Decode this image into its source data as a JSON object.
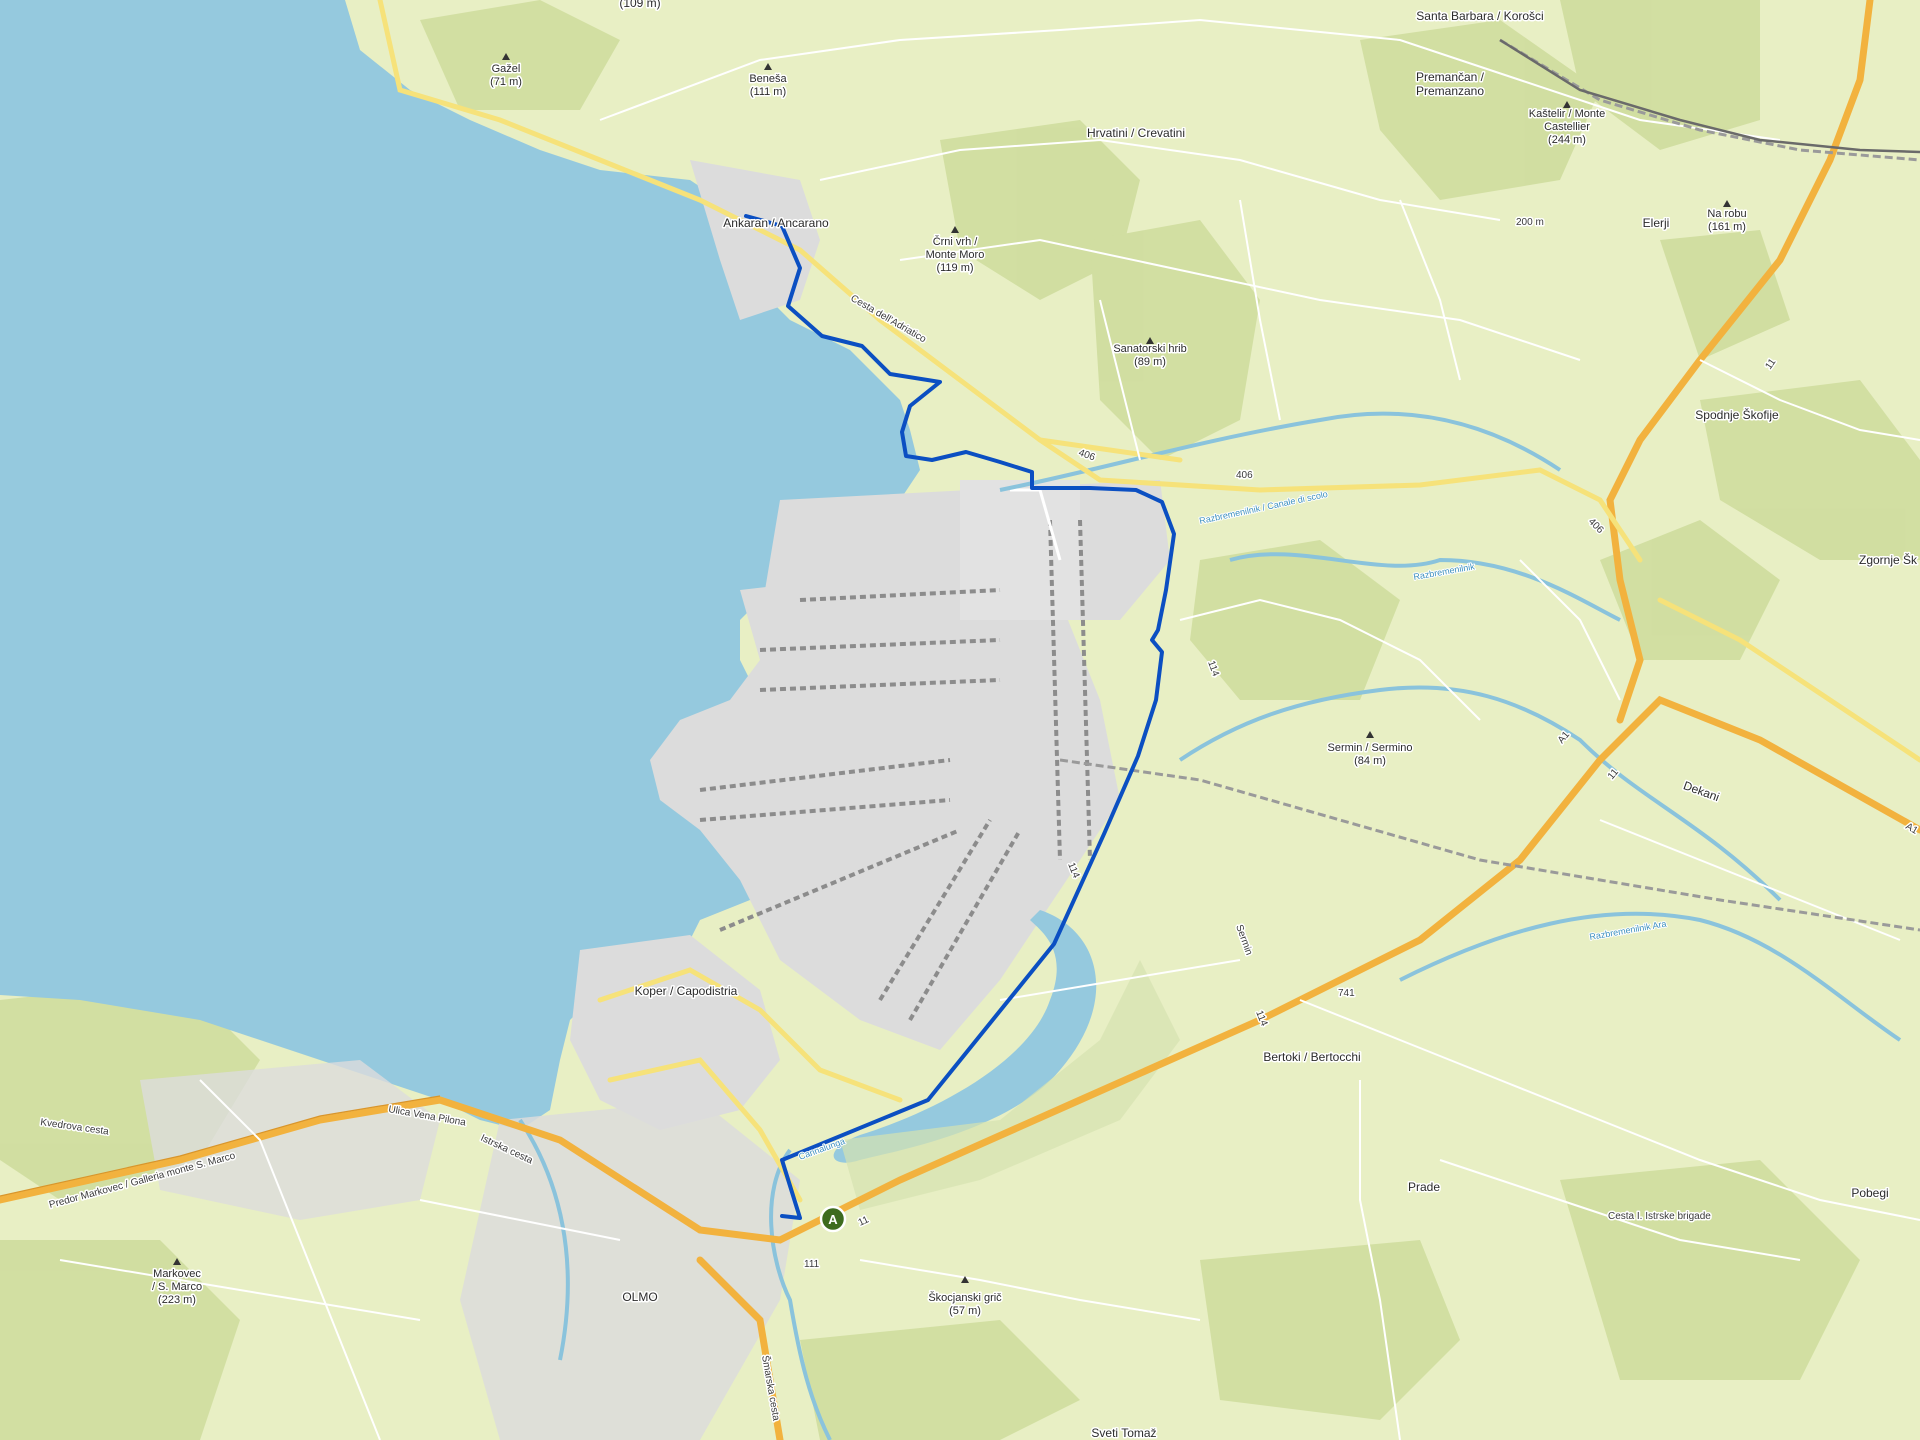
{
  "map": {
    "colors": {
      "sea": "#95c9de",
      "land": "#e8efc4",
      "forest": "#cfdd9e",
      "urban": "#dcdcdc",
      "motorway": "#f2b23e",
      "primary_road": "#f6e27a",
      "route": "#0b4fc2",
      "marker": "#3d6b1e"
    },
    "marker": {
      "label": "A"
    },
    "peaks": [
      {
        "name": "Gažel",
        "elev": "(71 m)"
      },
      {
        "name": "Beneša",
        "elev": "(111 m)"
      },
      {
        "name": "Črni vrh /",
        "name2": "Monte Moro",
        "elev": "(119 m)"
      },
      {
        "name": "Sanatorski hrib",
        "elev": "(89 m)"
      },
      {
        "name": "Kaštelir / Monte",
        "name2": "Castellier",
        "elev": "(244 m)"
      },
      {
        "name": "Na robu",
        "elev": "(161 m)"
      },
      {
        "name": "Sermin / Sermino",
        "elev": "(84 m)"
      },
      {
        "name": "Markovec",
        "name2": "/ S. Marco",
        "elev": "(223 m)"
      },
      {
        "name": "Škocjanski grič",
        "elev": "(57 m)"
      }
    ],
    "places": [
      "Ankaran / Ancarano",
      "Hrvatini / Crevatini",
      "Santa Barbara / Korošci",
      "Premančan /",
      "Premanzano",
      "Elerji",
      "Spodnje Škofije",
      "Zgornje Šk",
      "Dekani",
      "Koper / Capodistria",
      "Bertoki / Bertocchi",
      "Prade",
      "Pobegi",
      "OLMO",
      "Sveti Tomaž",
      "(109 m)"
    ],
    "roads": [
      "406",
      "406",
      "406",
      "Cesta dell'Adriatico",
      "11",
      "11",
      "11",
      "A1",
      "A1",
      "114",
      "114",
      "114",
      "741",
      "111",
      "Kvedrova cesta",
      "Predor Markovec / Galleria monte S. Marco",
      "Istrska cesta",
      "Ulica Vena Pilona",
      "Šmarska cesta",
      "Cesta I. Istrske brigade",
      "Sermin",
      "200 m"
    ],
    "waters": [
      "Razbremenilnik / Canale di scolo",
      "Razbremenilnik",
      "Razbremenilnik Ara",
      "Cannalunga"
    ]
  }
}
